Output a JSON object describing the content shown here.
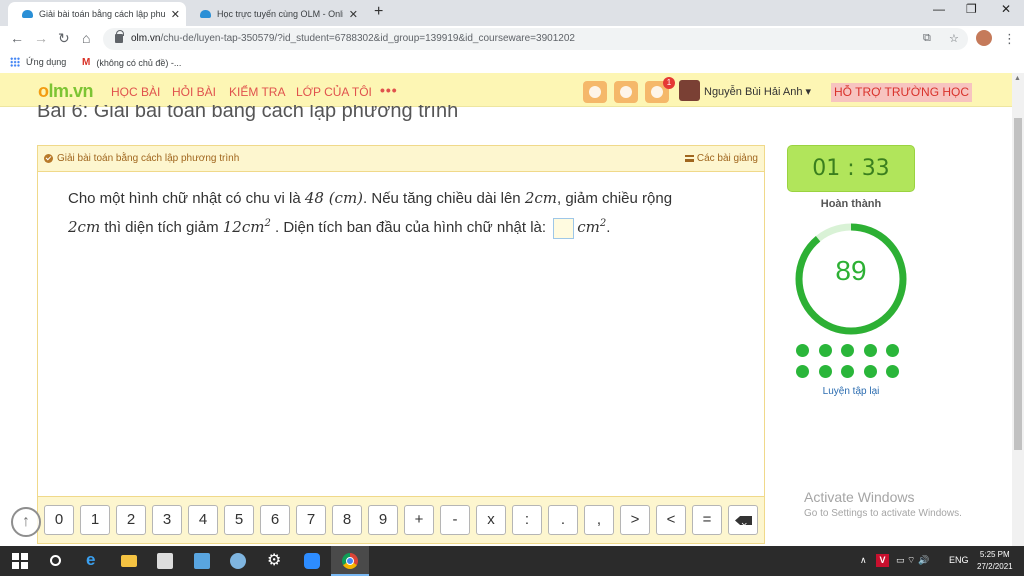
{
  "browser": {
    "tabs": [
      {
        "title": "Giải bài toán bằng cách lập phươ",
        "active": true
      },
      {
        "title": "Học trực tuyến cùng OLM - Onlin",
        "active": false
      }
    ],
    "new_tab": "+",
    "window_controls": {
      "minimize": "—",
      "restore": "❐",
      "close": "✕"
    },
    "tab_close": "✕",
    "nav": {
      "back": "←",
      "forward": "→",
      "reload": "↻",
      "home": "⌂"
    },
    "url_host": "olm.vn",
    "url_path": "/chu-de/luyen-tap-350579/?id_student=6788302&id_group=139919&id_courseware=3901202",
    "omni_icons": {
      "translate": "⧉",
      "star": "☆"
    },
    "menu": "⋮",
    "bookmarks": [
      {
        "label": "Ứng dụng",
        "icon": "apps-grid-icon"
      },
      {
        "label": "(không có chủ đề) -...",
        "icon": "gmail-icon"
      }
    ],
    "gmail_glyph": "M"
  },
  "olm": {
    "logo_o": "o",
    "logo_rest": "lm.vn",
    "nav": [
      "HỌC BÀI",
      "HỎI BÀI",
      "KIỂM TRA",
      "LỚP CỦA TÔI"
    ],
    "more": "•••",
    "notification_count": "1",
    "user_name": "Nguyễn Bùi Hải Anh ▾",
    "support": "HỖ TRỢ TRƯỜNG HỌC",
    "lesson_title": "Bài 6: Giải bài toán bằng cách lập phương trình"
  },
  "exercise": {
    "header_left": "Giải bài toán bằng cách lập phương trình",
    "header_right": "Các bài giảng",
    "q1": "Cho một hình chữ nhật có chu vi là ",
    "q1_m1": "48 (cm)",
    "q1_t2": ". Nếu tăng chiều dài lên ",
    "q1_m2": "2cm",
    "q1_t3": ", giảm chiều rộng",
    "q2_m1": "2cm",
    "q2_t1": " thì diện tích giảm ",
    "q2_m2": "12cm",
    "q2_sup": "2",
    "q2_t2": " . Diện tích ban đầu của hình chữ nhật là: ",
    "q2_unit": "cm",
    "q2_unit_sup": "2",
    "q2_end": "."
  },
  "keypad": {
    "keys": [
      "0",
      "1",
      "2",
      "3",
      "4",
      "5",
      "6",
      "7",
      "8",
      "9",
      "+",
      "-",
      "x",
      ":",
      ".",
      ",",
      ">",
      "<",
      "="
    ]
  },
  "scroll_top": "↑",
  "side": {
    "timer": "01 : 33",
    "done_label": "Hoàn thành",
    "score": "89",
    "progress": 0.89,
    "retry": "Luyện tập lại",
    "dots": 10
  },
  "watermark": {
    "line1": "Activate Windows",
    "line2": "Go to Settings to activate Windows."
  },
  "taskbar": {
    "gear": "⚙",
    "tray_up": "∧",
    "tray_v": "V",
    "tray_icons": "▭ ⌔ 🔊",
    "lang": "ENG",
    "time": "5:25 PM",
    "date": "27/2/2021"
  },
  "colors": {
    "accent_red": "#e0524d",
    "timer_green": "#b1e55b",
    "score_green": "#2db034",
    "header_yellow": "#fdf6b4"
  }
}
